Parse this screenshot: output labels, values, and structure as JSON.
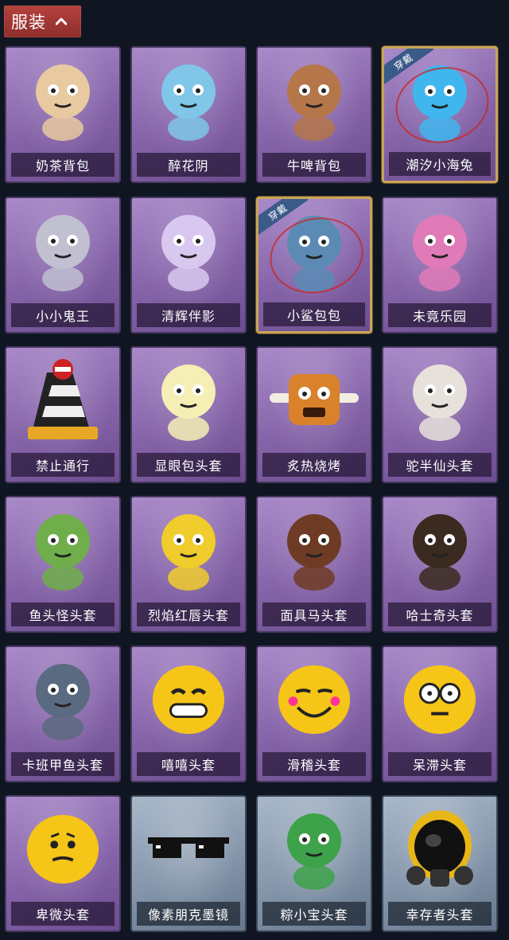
{
  "header": {
    "title": "服装",
    "chevron_icon": "chevron-up-icon"
  },
  "badge_text": "穿戴",
  "items": [
    {
      "label": "奶茶背包",
      "theme": "purple",
      "equipped": false,
      "icon": "milk-tea-backpack-icon",
      "color": "#e8c9a0"
    },
    {
      "label": "醉花阴",
      "theme": "purple",
      "equipped": false,
      "icon": "dreamcatcher-icon",
      "color": "#7fc6e8"
    },
    {
      "label": "牛啤背包",
      "theme": "purple",
      "equipped": false,
      "icon": "cow-beer-backpack-icon",
      "color": "#b5764a"
    },
    {
      "label": "潮汐小海兔",
      "theme": "purple",
      "equipped": true,
      "icon": "sea-bunny-icon",
      "color": "#3fb6ee"
    },
    {
      "label": "小小鬼王",
      "theme": "purple",
      "equipped": false,
      "icon": "ghost-king-icon",
      "color": "#c0c0d0"
    },
    {
      "label": "清辉伴影",
      "theme": "purple",
      "equipped": false,
      "icon": "moon-companion-icon",
      "color": "#d8c8f0"
    },
    {
      "label": "小鲨包包",
      "theme": "purple",
      "equipped": true,
      "icon": "shark-bag-icon",
      "color": "#5b8bb5"
    },
    {
      "label": "未竟乐园",
      "theme": "purple",
      "equipped": false,
      "icon": "paradise-girl-icon",
      "color": "#e07ab8"
    },
    {
      "label": "禁止通行",
      "theme": "purple",
      "equipped": false,
      "icon": "no-entry-cone-icon",
      "color": "#e8a825"
    },
    {
      "label": "显眼包头套",
      "theme": "purple",
      "equipped": false,
      "icon": "lightbulb-head-icon",
      "color": "#f5efb5"
    },
    {
      "label": "炙热烧烤",
      "theme": "purple",
      "equipped": false,
      "icon": "bbq-meat-icon",
      "color": "#d9822b"
    },
    {
      "label": "驼半仙头套",
      "theme": "purple",
      "equipped": false,
      "icon": "bear-sunglasses-head-icon",
      "color": "#e6e1da"
    },
    {
      "label": "鱼头怪头套",
      "theme": "purple",
      "equipped": false,
      "icon": "fish-head-icon",
      "color": "#6fae4a"
    },
    {
      "label": "烈焰红唇头套",
      "theme": "purple",
      "equipped": false,
      "icon": "yellow-mask-head-icon",
      "color": "#f0cc2c"
    },
    {
      "label": "面具马头套",
      "theme": "purple",
      "equipped": false,
      "icon": "horse-mask-icon",
      "color": "#6e3b25"
    },
    {
      "label": "哈士奇头套",
      "theme": "purple",
      "equipped": false,
      "icon": "husky-head-icon",
      "color": "#3a2a20"
    },
    {
      "label": "卡班甲鱼头套",
      "theme": "purple",
      "equipped": false,
      "icon": "turtle-head-icon",
      "color": "#5a6a80"
    },
    {
      "label": "嘻嘻头套",
      "theme": "purple",
      "equipped": false,
      "icon": "grin-emoji-head-icon",
      "color": "#f5c518"
    },
    {
      "label": "滑稽头套",
      "theme": "purple",
      "equipped": false,
      "icon": "funny-emoji-head-icon",
      "color": "#f5c518"
    },
    {
      "label": "呆滞头套",
      "theme": "purple",
      "equipped": false,
      "icon": "stunned-emoji-head-icon",
      "color": "#f5c518"
    },
    {
      "label": "卑微头套",
      "theme": "purple",
      "equipped": false,
      "icon": "humble-emoji-head-icon",
      "color": "#f5c518"
    },
    {
      "label": "像素朋克墨镜",
      "theme": "blue",
      "equipped": false,
      "icon": "pixel-sunglasses-icon",
      "color": "#111111"
    },
    {
      "label": "粽小宝头套",
      "theme": "blue",
      "equipped": false,
      "icon": "zongzi-head-icon",
      "color": "#3ea24a"
    },
    {
      "label": "幸存者头套",
      "theme": "blue",
      "equipped": false,
      "icon": "gas-mask-helmet-icon",
      "color": "#e8b617"
    }
  ]
}
